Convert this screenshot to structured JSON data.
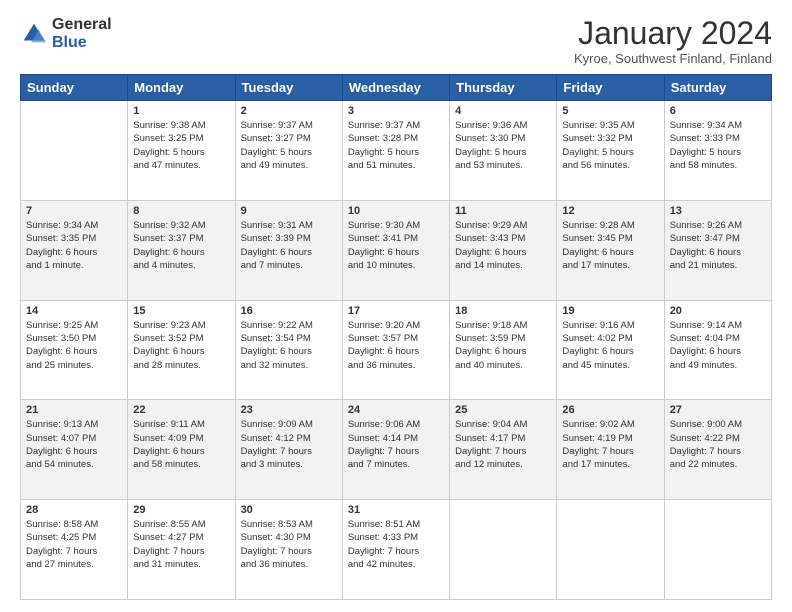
{
  "logo": {
    "general": "General",
    "blue": "Blue"
  },
  "header": {
    "month": "January 2024",
    "location": "Kyroe, Southwest Finland, Finland"
  },
  "weekdays": [
    "Sunday",
    "Monday",
    "Tuesday",
    "Wednesday",
    "Thursday",
    "Friday",
    "Saturday"
  ],
  "weeks": [
    [
      {
        "day": "",
        "info": ""
      },
      {
        "day": "1",
        "info": "Sunrise: 9:38 AM\nSunset: 3:25 PM\nDaylight: 5 hours\nand 47 minutes."
      },
      {
        "day": "2",
        "info": "Sunrise: 9:37 AM\nSunset: 3:27 PM\nDaylight: 5 hours\nand 49 minutes."
      },
      {
        "day": "3",
        "info": "Sunrise: 9:37 AM\nSunset: 3:28 PM\nDaylight: 5 hours\nand 51 minutes."
      },
      {
        "day": "4",
        "info": "Sunrise: 9:36 AM\nSunset: 3:30 PM\nDaylight: 5 hours\nand 53 minutes."
      },
      {
        "day": "5",
        "info": "Sunrise: 9:35 AM\nSunset: 3:32 PM\nDaylight: 5 hours\nand 56 minutes."
      },
      {
        "day": "6",
        "info": "Sunrise: 9:34 AM\nSunset: 3:33 PM\nDaylight: 5 hours\nand 58 minutes."
      }
    ],
    [
      {
        "day": "7",
        "info": "Sunrise: 9:34 AM\nSunset: 3:35 PM\nDaylight: 6 hours\nand 1 minute."
      },
      {
        "day": "8",
        "info": "Sunrise: 9:32 AM\nSunset: 3:37 PM\nDaylight: 6 hours\nand 4 minutes."
      },
      {
        "day": "9",
        "info": "Sunrise: 9:31 AM\nSunset: 3:39 PM\nDaylight: 6 hours\nand 7 minutes."
      },
      {
        "day": "10",
        "info": "Sunrise: 9:30 AM\nSunset: 3:41 PM\nDaylight: 6 hours\nand 10 minutes."
      },
      {
        "day": "11",
        "info": "Sunrise: 9:29 AM\nSunset: 3:43 PM\nDaylight: 6 hours\nand 14 minutes."
      },
      {
        "day": "12",
        "info": "Sunrise: 9:28 AM\nSunset: 3:45 PM\nDaylight: 6 hours\nand 17 minutes."
      },
      {
        "day": "13",
        "info": "Sunrise: 9:26 AM\nSunset: 3:47 PM\nDaylight: 6 hours\nand 21 minutes."
      }
    ],
    [
      {
        "day": "14",
        "info": "Sunrise: 9:25 AM\nSunset: 3:50 PM\nDaylight: 6 hours\nand 25 minutes."
      },
      {
        "day": "15",
        "info": "Sunrise: 9:23 AM\nSunset: 3:52 PM\nDaylight: 6 hours\nand 28 minutes."
      },
      {
        "day": "16",
        "info": "Sunrise: 9:22 AM\nSunset: 3:54 PM\nDaylight: 6 hours\nand 32 minutes."
      },
      {
        "day": "17",
        "info": "Sunrise: 9:20 AM\nSunset: 3:57 PM\nDaylight: 6 hours\nand 36 minutes."
      },
      {
        "day": "18",
        "info": "Sunrise: 9:18 AM\nSunset: 3:59 PM\nDaylight: 6 hours\nand 40 minutes."
      },
      {
        "day": "19",
        "info": "Sunrise: 9:16 AM\nSunset: 4:02 PM\nDaylight: 6 hours\nand 45 minutes."
      },
      {
        "day": "20",
        "info": "Sunrise: 9:14 AM\nSunset: 4:04 PM\nDaylight: 6 hours\nand 49 minutes."
      }
    ],
    [
      {
        "day": "21",
        "info": "Sunrise: 9:13 AM\nSunset: 4:07 PM\nDaylight: 6 hours\nand 54 minutes."
      },
      {
        "day": "22",
        "info": "Sunrise: 9:11 AM\nSunset: 4:09 PM\nDaylight: 6 hours\nand 58 minutes."
      },
      {
        "day": "23",
        "info": "Sunrise: 9:09 AM\nSunset: 4:12 PM\nDaylight: 7 hours\nand 3 minutes."
      },
      {
        "day": "24",
        "info": "Sunrise: 9:06 AM\nSunset: 4:14 PM\nDaylight: 7 hours\nand 7 minutes."
      },
      {
        "day": "25",
        "info": "Sunrise: 9:04 AM\nSunset: 4:17 PM\nDaylight: 7 hours\nand 12 minutes."
      },
      {
        "day": "26",
        "info": "Sunrise: 9:02 AM\nSunset: 4:19 PM\nDaylight: 7 hours\nand 17 minutes."
      },
      {
        "day": "27",
        "info": "Sunrise: 9:00 AM\nSunset: 4:22 PM\nDaylight: 7 hours\nand 22 minutes."
      }
    ],
    [
      {
        "day": "28",
        "info": "Sunrise: 8:58 AM\nSunset: 4:25 PM\nDaylight: 7 hours\nand 27 minutes."
      },
      {
        "day": "29",
        "info": "Sunrise: 8:55 AM\nSunset: 4:27 PM\nDaylight: 7 hours\nand 31 minutes."
      },
      {
        "day": "30",
        "info": "Sunrise: 8:53 AM\nSunset: 4:30 PM\nDaylight: 7 hours\nand 36 minutes."
      },
      {
        "day": "31",
        "info": "Sunrise: 8:51 AM\nSunset: 4:33 PM\nDaylight: 7 hours\nand 42 minutes."
      },
      {
        "day": "",
        "info": ""
      },
      {
        "day": "",
        "info": ""
      },
      {
        "day": "",
        "info": ""
      }
    ]
  ]
}
